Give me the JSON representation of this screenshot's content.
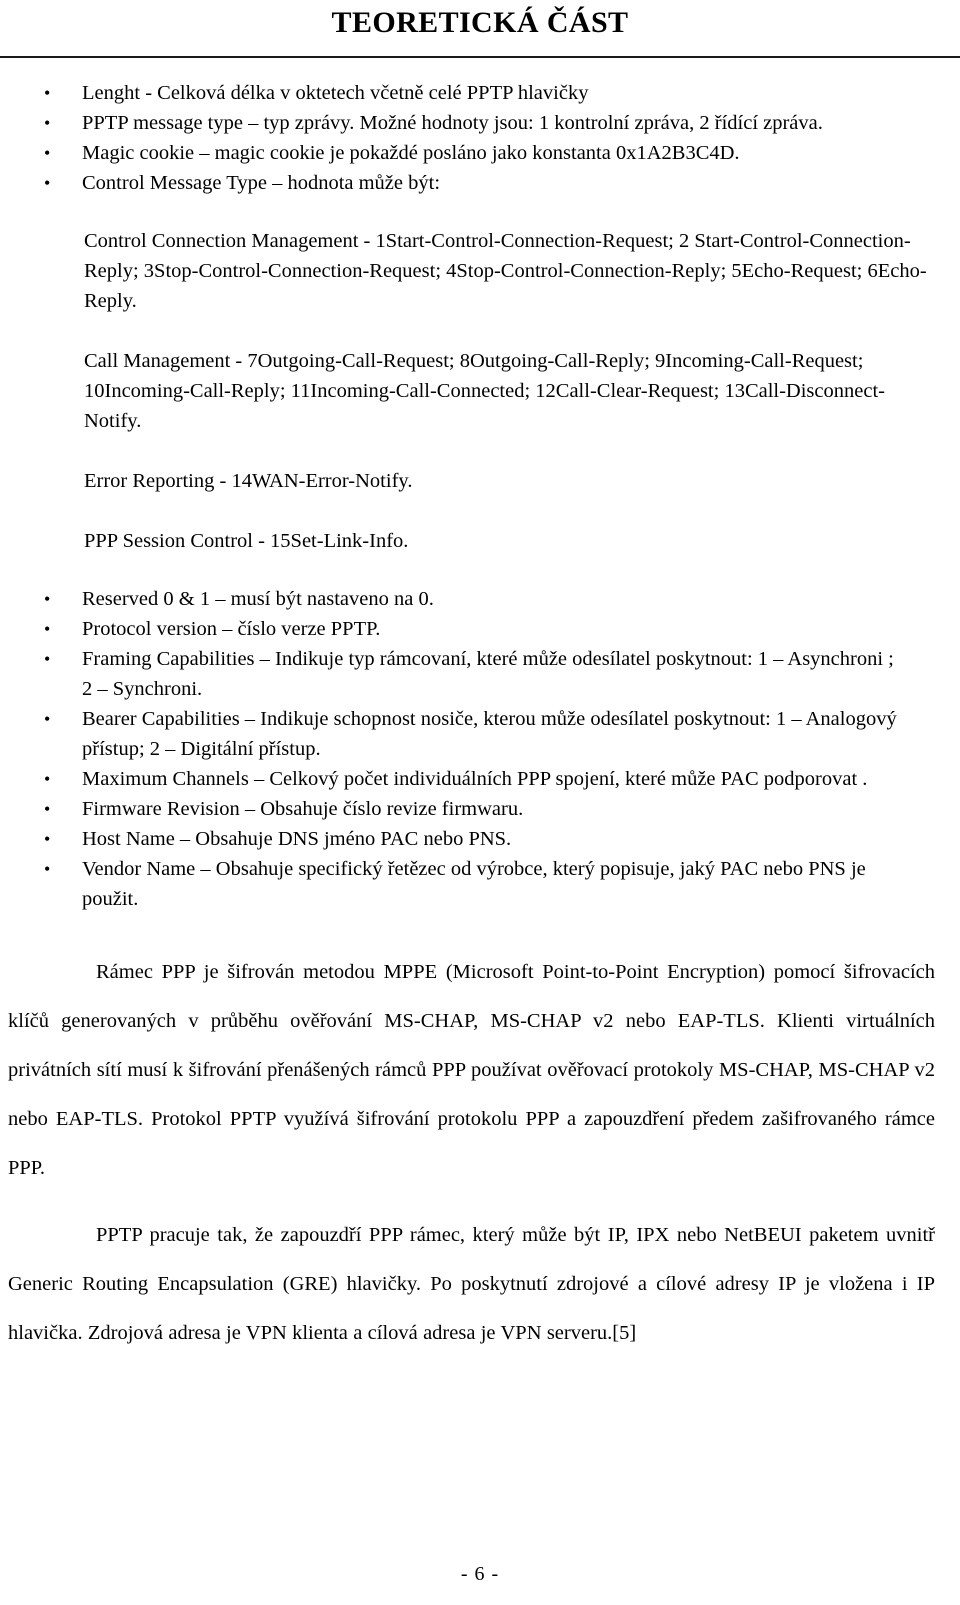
{
  "header": {
    "title": "TEORETICKÁ ČÁST"
  },
  "bullets_group_a": [
    {
      "id": "lenght",
      "marker": "•",
      "text": "Lenght  - Celková délka v oktetech včetně celé PPTP hlavičky"
    },
    {
      "id": "pptp-message-type",
      "marker": "•",
      "text": "PPTP message type – typ zprávy. Možné hodnoty jsou: 1 kontrolní zpráva, 2  řídící zpráva."
    },
    {
      "id": "magic-cookie",
      "marker": "•",
      "text": "Magic cookie – magic cookie je pokaždé  posláno jako konstanta 0x1A2B3C4D."
    },
    {
      "id": "control-message-type",
      "marker": "•",
      "text": "Control Message Type – hodnota může být:"
    }
  ],
  "control_message_values": [
    {
      "id": "control-connection-management",
      "text": "Control Connection Management - 1Start-Control-Connection-Request;  2 Start-Control-Connection-Reply; 3Stop-Control-Connection-Request; 4Stop-Control-Connection-Reply; 5Echo-Request; 6Echo-Reply."
    },
    {
      "id": "call-management",
      "text": "Call Management - 7Outgoing-Call-Request; 8Outgoing-Call-Reply; 9Incoming-Call-Request; 10Incoming-Call-Reply; 11Incoming-Call-Connected; 12Call-Clear-Request; 13Call-Disconnect-Notify."
    },
    {
      "id": "error-reporting",
      "text": "Error Reporting - 14WAN-Error-Notify."
    },
    {
      "id": "ppp-session-control",
      "text": "PPP Session Control - 15Set-Link-Info."
    }
  ],
  "bullets_group_b": [
    {
      "id": "reserved",
      "marker": "•",
      "text": "Reserved 0 & 1 – musí být nastaveno na 0."
    },
    {
      "id": "protocol-version",
      "marker": "•",
      "text": "Protocol version – číslo verze PPTP."
    },
    {
      "id": "framing-capabilities",
      "marker": "•",
      "text": "Framing Capabilities – Indikuje typ rámcovaní, které může odesílatel poskytnout: 1 – Asynchroni ; 2 – Synchroni."
    },
    {
      "id": "bearer-capabilities",
      "marker": "•",
      "text": "Bearer Capabilities – Indikuje schopnost nosiče, kterou může odesílatel poskytnout: 1 – Analogový přístup; 2 – Digitální přístup."
    },
    {
      "id": "maximum-channels",
      "marker": "•",
      "text": "Maximum Channels – Celkový počet individuálních PPP spojení, které může PAC podporovat ."
    },
    {
      "id": "firmware-revision",
      "marker": "•",
      "text": "Firmware Revision – Obsahuje číslo revize firmwaru."
    },
    {
      "id": "host-name",
      "marker": "•",
      "text": "Host Name – Obsahuje DNS jméno  PAC nebo PNS."
    },
    {
      "id": "vendor-name",
      "marker": "•",
      "text": "Vendor Name – Obsahuje specifický řetězec od výrobce, který popisuje, jaký PAC nebo PNS je použit."
    }
  ],
  "paragraphs": [
    {
      "id": "mppe-paragraph",
      "text": "Rámec PPP je šifrován metodou MPPE (Microsoft Point-to-Point Encryption) pomocí šifrovacích klíčů generovaných v průběhu ověřování MS-CHAP, MS-CHAP v2 nebo EAP-TLS. Klienti virtuálních privátních sítí musí k šifrování přenášených rámců PPP používat ověřovací protokoly MS-CHAP, MS-CHAP v2 nebo EAP-TLS. Protokol PPTP využívá šifrování protokolu PPP a zapouzdření předem zašifrovaného rámce PPP."
    },
    {
      "id": "gre-paragraph",
      "text": "PPTP pracuje tak, že zapouzdří PPP rámec, který může být IP, IPX nebo NetBEUI paketem uvnitř Generic Routing Encapsulation (GRE) hlavičky. Po poskytnutí zdrojové a cílové adresy IP je vložena i IP hlavička. Zdrojová adresa je VPN klienta a cílová adresa je VPN serveru.[5]"
    }
  ],
  "footer": {
    "page_number": "- 6 -"
  }
}
